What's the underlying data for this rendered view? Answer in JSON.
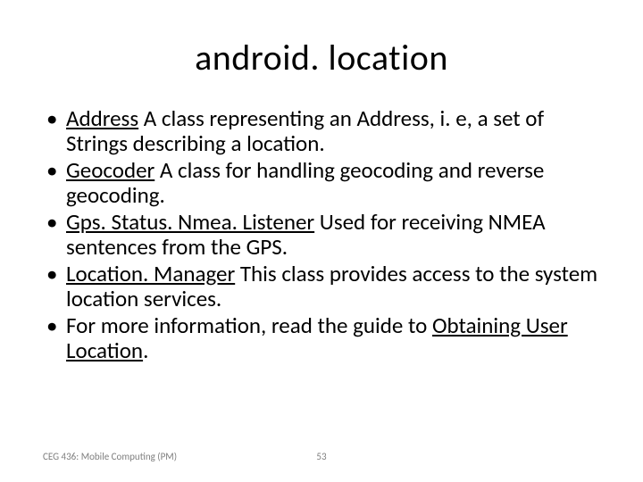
{
  "title": "android. location",
  "bullets": [
    {
      "link": "Address",
      "rest": " A class representing an Address, i. e, a set of Strings describing a location."
    },
    {
      "link": "Geocoder",
      "rest": " A class for handling geocoding and reverse geocoding."
    },
    {
      "link": "Gps. Status. Nmea. Listener",
      "rest": " Used for receiving NMEA sentences from the GPS."
    },
    {
      "link": "Location. Manager",
      "rest": " This class provides access to the system location services."
    },
    {
      "pre": "For more information, read the guide to ",
      "link": "Obtaining User Location",
      "post": "."
    }
  ],
  "footer": {
    "course": "CEG 436: Mobile Computing (PM)",
    "page": "53"
  }
}
